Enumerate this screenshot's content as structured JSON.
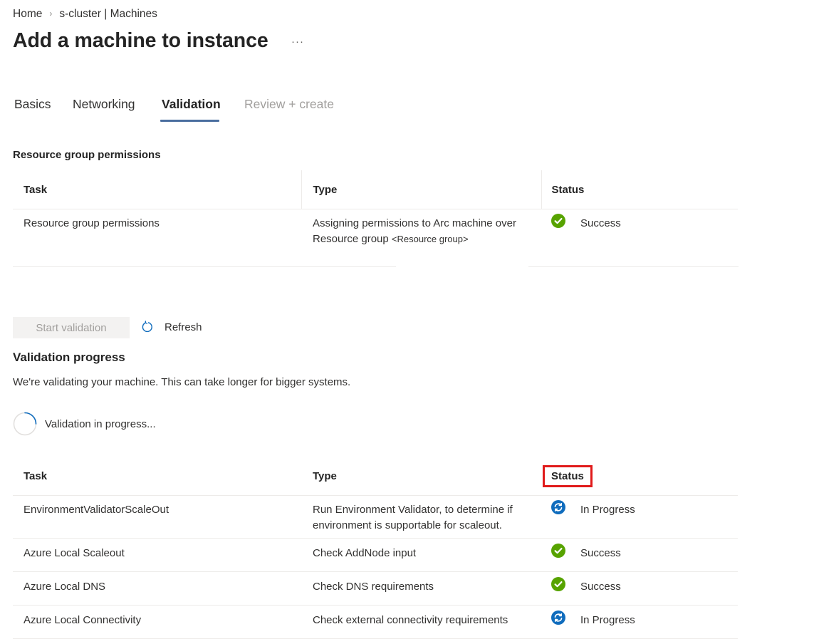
{
  "breadcrumb": {
    "home": "Home",
    "separator": "›",
    "current": "s-cluster | Machines"
  },
  "title": "Add a machine to instance",
  "more_label": "···",
  "tabs": [
    {
      "label": "Basics",
      "state": "normal"
    },
    {
      "label": "Networking",
      "state": "normal"
    },
    {
      "label": "Validation",
      "state": "active"
    },
    {
      "label": "Review + create",
      "state": "disabled"
    }
  ],
  "permissions": {
    "section_label": "Resource group permissions",
    "columns": {
      "task": "Task",
      "type": "Type",
      "status": "Status"
    },
    "row": {
      "task": "Resource group permissions",
      "type_line1": "Assigning permissions to Arc machine over",
      "type_line2_prefix": "Resource group",
      "type_line2_placeholder": "<Resource group>",
      "status": "Success"
    }
  },
  "actions": {
    "start_validation": "Start validation",
    "refresh": "Refresh"
  },
  "validation_progress": {
    "title": "Validation progress",
    "description": "We're validating your machine. This can take longer for bigger systems.",
    "spinner_text": "Validation in progress..."
  },
  "validation_table": {
    "columns": {
      "task": "Task",
      "type": "Type",
      "status": "Status"
    },
    "rows": [
      {
        "task": "EnvironmentValidatorScaleOut",
        "type_line1": "Run Environment Validator, to determine if",
        "type_line2": "environment is supportable for scaleout.",
        "status": "In Progress",
        "status_kind": "in-progress"
      },
      {
        "task": "Azure Local Scaleout",
        "type_line1": "Check AddNode input",
        "status": "Success",
        "status_kind": "success"
      },
      {
        "task": "Azure Local DNS",
        "type_line1": "Check DNS requirements",
        "status": "Success",
        "status_kind": "success"
      },
      {
        "task": "Azure Local Connectivity",
        "type_line1": "Check external connectivity requirements",
        "status": "In Progress",
        "status_kind": "in-progress"
      }
    ]
  },
  "colors": {
    "success": "#57a300",
    "in_progress": "#0f6cbd",
    "tab_underline": "#4a6e9f",
    "highlight_box": "#e01a1a"
  },
  "icons": {
    "success": "success-check-icon",
    "in_progress": "sync-icon",
    "refresh": "refresh-icon",
    "more": "more-ellipsis-icon"
  }
}
